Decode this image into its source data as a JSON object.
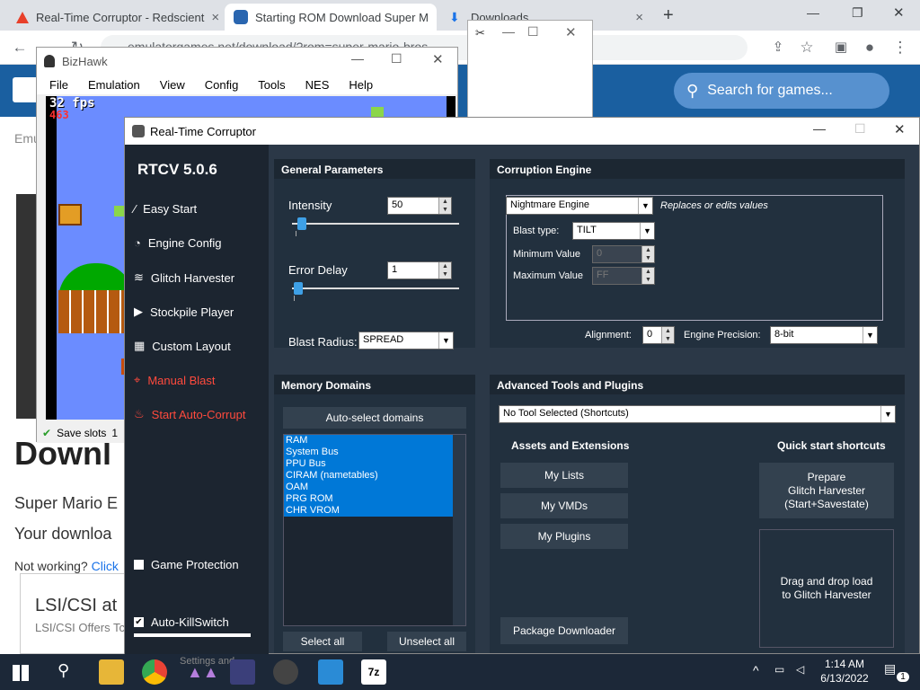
{
  "chrome": {
    "tabs": [
      {
        "title": "Real-Time Corruptor - Redscient",
        "close": "×"
      },
      {
        "title": "Starting ROM Download Super M",
        "close": "×"
      },
      {
        "title": "Downloads",
        "close": "×"
      }
    ],
    "new_tab": "+",
    "url": "emulatorgames.net/download/?rom=super-mario-bros",
    "window_min": "—",
    "window_restore": "❐",
    "window_close": "✕"
  },
  "site": {
    "search_placeholder": "Search for games...",
    "breadcrumb_fragment": "Emu",
    "heading_fragment": "Downl",
    "line1": "Super Mario E",
    "line2": "Your downloa",
    "not_working": "Not working?",
    "click": "Click",
    "ad_title": "LSI/CSI at",
    "ad_sub": "LSI/CSI Offers Tc"
  },
  "bizhawk": {
    "title": "BizHawk",
    "menu": [
      "File",
      "Emulation",
      "View",
      "Config",
      "Tools",
      "NES",
      "Help"
    ],
    "fps": "32 fps",
    "frame": "463",
    "status_saveslots": "Save slots",
    "status_slot": "1"
  },
  "rtc": {
    "title": "Real-Time Corruptor",
    "version": "RTCV 5.0.6",
    "sidebar": {
      "items": [
        {
          "label": "Easy Start",
          "icon": "wand-icon"
        },
        {
          "label": "Engine Config",
          "icon": "gauge-icon"
        },
        {
          "label": "Glitch Harvester",
          "icon": "layers-icon"
        },
        {
          "label": "Stockpile Player",
          "icon": "play-icon"
        },
        {
          "label": "Custom Layout",
          "icon": "grid-icon"
        },
        {
          "label": "Manual Blast",
          "icon": "crosshair-icon"
        },
        {
          "label": "Start Auto-Corrupt",
          "icon": "flame-icon"
        }
      ],
      "game_protection": "Game Protection",
      "auto_killswitch": "Auto-KillSwitch"
    },
    "general": {
      "header": "General Parameters",
      "intensity_label": "Intensity",
      "intensity_value": "50",
      "intensity_level": 0.02,
      "error_delay_label": "Error Delay",
      "error_delay_value": "1",
      "error_delay_level": 0.0,
      "blast_radius_label": "Blast Radius:",
      "blast_radius_value": "SPREAD"
    },
    "engine": {
      "header": "Corruption Engine",
      "engine_value": "Nightmare Engine",
      "engine_desc": "Replaces or edits values",
      "blast_type_label": "Blast type:",
      "blast_type_value": "TILT",
      "min_label": "Minimum Value",
      "min_value": "0",
      "max_label": "Maximum Value",
      "max_value": "FF",
      "alignment_label": "Alignment:",
      "alignment_value": "0",
      "precision_label": "Engine Precision:",
      "precision_value": "8-bit"
    },
    "memory": {
      "header": "Memory Domains",
      "auto_select": "Auto-select domains",
      "domains": [
        "RAM",
        "System Bus",
        "PPU Bus",
        "CIRAM (nametables)",
        "OAM",
        "PRG ROM",
        "CHR VROM"
      ],
      "select_all": "Select all",
      "unselect_all": "Unselect all"
    },
    "advanced": {
      "header": "Advanced Tools and Plugins",
      "tool_select": "No Tool Selected (Shortcuts)",
      "assets_header": "Assets and Extensions",
      "my_lists": "My Lists",
      "my_vmds": "My VMDs",
      "my_plugins": "My Plugins",
      "package_downloader": "Package Downloader",
      "quick_header": "Quick start shortcuts",
      "prepare": "Prepare\nGlitch Harvester\n(Start+Savestate)",
      "drag_drop": "Drag and drop load\nto Glitch Harvester"
    }
  },
  "taskbar": {
    "time": "1:14 AM",
    "date": "6/13/2022",
    "notifications": "1",
    "ghost_text": "Settings and"
  },
  "colors": {
    "rtc_bg": "#2b3847",
    "accent_blue": "#0078d7",
    "manual_blast_red": "#ff4a3d",
    "site_header": "#1a5fa0"
  }
}
